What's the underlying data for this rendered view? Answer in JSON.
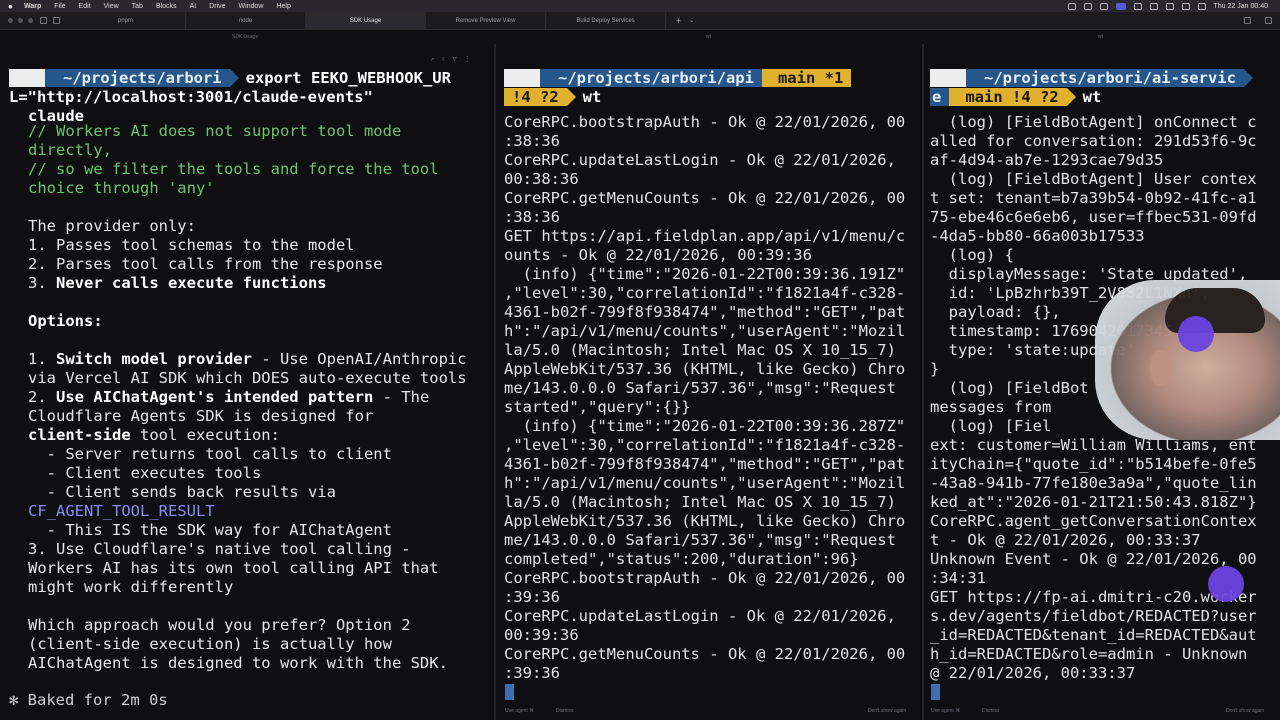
{
  "menubar": {
    "apple": "",
    "items": [
      "Warp",
      "File",
      "Edit",
      "View",
      "Tab",
      "Blocks",
      "AI",
      "Drive",
      "Window",
      "Help"
    ],
    "clock": "Thu 22 Jan 00:40"
  },
  "tabs": [
    {
      "label": "pnpm",
      "active": false
    },
    {
      "label": "node",
      "active": false
    },
    {
      "label": "SDK Usage",
      "active": true
    },
    {
      "label": "Remove Preview View",
      "active": false
    },
    {
      "label": "Build Deploy Services",
      "active": false
    }
  ],
  "tab_plus": "+",
  "tab_chevron": "⌄",
  "panes": {
    "left_label": "SDK Usage",
    "mid_label": "wt",
    "right_label": "wt"
  },
  "left": {
    "prompt_path": "~/projects/arbori",
    "prompt_cmd": "export EEKO_WEBHOOK_UR",
    "cmd_cont": "L=\"http://localhost:3001/claude-events\"",
    "cmd_cont2": "claude",
    "lines": [
      {
        "t": "// Workers AI does not support tool mode",
        "c": "g"
      },
      {
        "t": "directly,",
        "c": "g"
      },
      {
        "t": "// so we filter the tools and force the tool",
        "c": "g"
      },
      {
        "t": "choice through 'any'",
        "c": "g"
      },
      {
        "t": "",
        "c": ""
      },
      {
        "t": "The provider only:",
        "c": ""
      },
      {
        "t": "1. Passes tool schemas to the model",
        "c": ""
      },
      {
        "t": "2. Parses tool calls from the response",
        "c": ""
      },
      {
        "t": "3. Never calls execute functions",
        "c": "b3"
      },
      {
        "t": "",
        "c": ""
      },
      {
        "t": "Options:",
        "c": "b"
      },
      {
        "t": "",
        "c": ""
      },
      {
        "t": "1. Switch model provider - Use OpenAI/Anthropic",
        "c": "o1"
      },
      {
        "t": "via Vercel AI SDK which DOES auto-execute tools",
        "c": ""
      },
      {
        "t": "2. Use AIChatAgent's intended pattern - The",
        "c": "o2"
      },
      {
        "t": "Cloudflare Agents SDK is designed for",
        "c": ""
      },
      {
        "t": "client-side tool execution:",
        "c": "o3"
      },
      {
        "t": "  - Server returns tool calls to client",
        "c": ""
      },
      {
        "t": "  - Client executes tools",
        "c": ""
      },
      {
        "t": "  - Client sends back results via",
        "c": ""
      },
      {
        "t": "CF_AGENT_TOOL_RESULT",
        "c": "p"
      },
      {
        "t": "  - This IS the SDK way for AIChatAgent",
        "c": ""
      },
      {
        "t": "3. Use Cloudflare's native tool calling -",
        "c": "o4"
      },
      {
        "t": "Workers AI has its own tool calling API that",
        "c": ""
      },
      {
        "t": "might work differently",
        "c": ""
      },
      {
        "t": "",
        "c": ""
      },
      {
        "t": "Which approach would you prefer? Option 2",
        "c": ""
      },
      {
        "t": "(client-side execution) is actually how",
        "c": ""
      },
      {
        "t": "AIChatAgent is designed to work with the SDK.",
        "c": ""
      }
    ],
    "status": "✻ Baked for 2m 0s"
  },
  "mid": {
    "prompt_path": "~/projects/arbori/api",
    "branch": "main *1",
    "prompt_line2_badge": "!4 ?2",
    "prompt_line2_cmd": "wt",
    "lines": [
      "CoreRPC.bootstrapAuth - Ok @ 22/01/2026, 00",
      ":38:36",
      "CoreRPC.updateLastLogin - Ok @ 22/01/2026,",
      "00:38:36",
      "CoreRPC.getMenuCounts - Ok @ 22/01/2026, 00",
      ":38:36",
      "GET https://api.fieldplan.app/api/v1/menu/c",
      "ounts - Ok @ 22/01/2026, 00:39:36",
      "  (info) {\"time\":\"2026-01-22T00:39:36.191Z\"",
      ",\"level\":30,\"correlationId\":\"f1821a4f-c328-",
      "4361-b02f-799f8f938474\",\"method\":\"GET\",\"pat",
      "h\":\"/api/v1/menu/counts\",\"userAgent\":\"Mozil",
      "la/5.0 (Macintosh; Intel Mac OS X 10_15_7)",
      "AppleWebKit/537.36 (KHTML, like Gecko) Chro",
      "me/143.0.0.0 Safari/537.36\",\"msg\":\"Request",
      "started\",\"query\":{}}",
      "  (info) {\"time\":\"2026-01-22T00:39:36.287Z\"",
      ",\"level\":30,\"correlationId\":\"f1821a4f-c328-",
      "4361-b02f-799f8f938474\",\"method\":\"GET\",\"pat",
      "h\":\"/api/v1/menu/counts\",\"userAgent\":\"Mozil",
      "la/5.0 (Macintosh; Intel Mac OS X 10_15_7)",
      "AppleWebKit/537.36 (KHTML, like Gecko) Chro",
      "me/143.0.0.0 Safari/537.36\",\"msg\":\"Request",
      "completed\",\"status\":200,\"duration\":96}",
      "CoreRPC.bootstrapAuth - Ok @ 22/01/2026, 00",
      ":39:36",
      "CoreRPC.updateLastLogin - Ok @ 22/01/2026,",
      "00:39:36",
      "CoreRPC.getMenuCounts - Ok @ 22/01/2026, 00",
      ":39:36"
    ],
    "footer_left": "Use agent ⌘",
    "footer_dismiss": "Dismiss",
    "footer_right": "Don't show again"
  },
  "right": {
    "prompt_path": "~/projects/arbori/ai-servic",
    "prompt_path_cont": "e",
    "branch": "main !4 ?2",
    "prompt_cmd": "wt",
    "lines": [
      "  (log) [FieldBotAgent] onConnect c",
      "alled for conversation: 291d53f6-9c",
      "af-4d94-ab7e-1293cae79d35",
      "  (log) [FieldBotAgent] User contex",
      "t set: tenant=b7a39b54-0b92-41fc-a1",
      "75-ebe46c6e6eb6, user=ffbec531-09fd",
      "-4da5-bb80-66a003b17533",
      "  (log) {",
      "  displayMessage: 'State updated',",
      "  id: 'LpBzhrb39T_2V882L1NXn',",
      "  payload: {},",
      "  timestamp: 1769042017345",
      "  type: 'state:update'",
      "}",
      "  (log) [FieldBot",
      "messages from",
      "  (log) [Fiel",
      "ext: customer=William Williams, ent",
      "ityChain={\"quote_id\":\"b514befe-0fe5",
      "-43a8-941b-77fe180e3a9a\",\"quote_lin",
      "ked_at\":\"2026-01-21T21:50:43.818Z\"}",
      "CoreRPC.agent_getConversationContex",
      "t - Ok @ 22/01/2026, 00:33:37",
      "Unknown Event - Ok @ 22/01/2026, 00",
      ":34:31",
      "GET https://fp-ai.dmitri-c20.worker",
      "s.dev/agents/fieldbot/REDACTED?user",
      "_id=REDACTED&tenant_id=REDACTED&aut",
      "h_id=REDACTED&role=admin - Unknown",
      "@ 22/01/2026, 00:33:37"
    ],
    "footer_left": "Use agent ⌘",
    "footer_dismiss": "Dismiss",
    "footer_right": "Don't show again"
  },
  "colors": {
    "prompt_blue": "#25578a",
    "prompt_gold": "#e0b02e",
    "comment_green": "#6cc46c",
    "link_purple": "#8a8ef0"
  }
}
